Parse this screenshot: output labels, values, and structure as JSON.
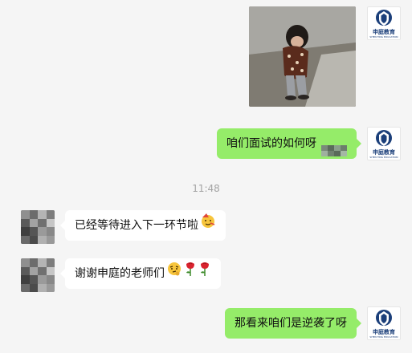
{
  "brand": {
    "logo_text": "申庭教育",
    "logo_subtext": "SHEN TING EDUCATION"
  },
  "colors": {
    "outgoing_bubble": "#95ec69",
    "incoming_bubble": "#ffffff",
    "background": "#f5f5f5",
    "logo_blue": "#1b3f7a"
  },
  "messages": [
    {
      "side": "right",
      "type": "image",
      "description_icon": "photo-thumbnail"
    },
    {
      "side": "right",
      "type": "text",
      "text": "咱们面试的如何呀",
      "extra": "censored-block"
    },
    {
      "side": "center",
      "type": "time",
      "text": "11:48"
    },
    {
      "side": "left",
      "type": "text",
      "text": "已经等待进入下一环节啦",
      "emojis": [
        "party-face-emoji"
      ]
    },
    {
      "side": "left",
      "type": "text",
      "text": "谢谢申庭的老师们",
      "emojis": [
        "thinking-face-emoji",
        "rose-emoji",
        "rose-emoji"
      ]
    },
    {
      "side": "right",
      "type": "text",
      "text": "那看来咱们是逆袭了呀"
    }
  ]
}
